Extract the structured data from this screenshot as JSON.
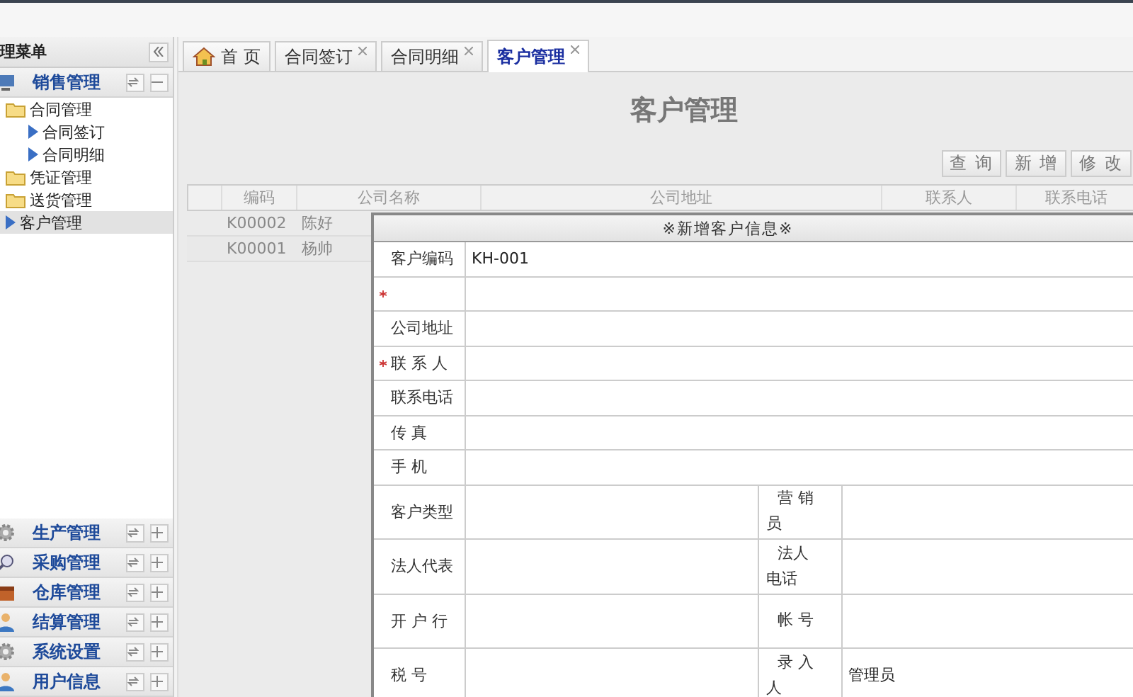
{
  "sidebar": {
    "title": "理菜单",
    "panels": [
      {
        "title": "销售管理",
        "kind": "sales",
        "expanded": true,
        "items": [
          {
            "label": "合同管理",
            "kind": "folder",
            "selected": false,
            "children": [
              {
                "label": "合同签订",
                "kind": "leaf",
                "selected": false
              },
              {
                "label": "合同明细",
                "kind": "leaf",
                "selected": false
              }
            ]
          },
          {
            "label": "凭证管理",
            "kind": "folder",
            "selected": false
          },
          {
            "label": "送货管理",
            "kind": "folder",
            "selected": false
          },
          {
            "label": "客户管理",
            "kind": "leaf",
            "selected": true
          }
        ]
      },
      {
        "title": "生产管理",
        "kind": "gear",
        "expanded": false
      },
      {
        "title": "采购管理",
        "kind": "search",
        "expanded": false
      },
      {
        "title": "仓库管理",
        "kind": "box",
        "expanded": false
      },
      {
        "title": "结算管理",
        "kind": "user",
        "expanded": false
      },
      {
        "title": "系统设置",
        "kind": "gear",
        "expanded": false
      },
      {
        "title": "用户信息",
        "kind": "user",
        "expanded": false
      }
    ]
  },
  "tabs": [
    {
      "label": "首 页",
      "kind": "home",
      "selected": false
    },
    {
      "label": "合同签订",
      "kind": "closable",
      "selected": false
    },
    {
      "label": "合同明细",
      "kind": "closable",
      "selected": false
    },
    {
      "label": "客户管理",
      "kind": "closable",
      "selected": true
    }
  ],
  "page": {
    "title": "客户管理",
    "buttons": [
      "查 询",
      "新 增",
      "修 改"
    ],
    "table": {
      "columns": [
        "编码",
        "公司名称",
        "公司地址",
        "联系人",
        "联系电话"
      ],
      "rows": [
        [
          "K00002",
          "陈好"
        ],
        [
          "K00001",
          "杨帅"
        ]
      ]
    }
  },
  "dialog": {
    "title": "※新增客户信息※",
    "rows": [
      {
        "kind": "single",
        "label": "客户编码",
        "required": false,
        "value": "KH-001"
      },
      {
        "kind": "single",
        "required": true
      },
      {
        "kind": "single",
        "label": "公司地址",
        "required": false
      },
      {
        "kind": "single",
        "label": "联 系 人",
        "required": true
      },
      {
        "kind": "single",
        "label": "联系电话",
        "required": false
      },
      {
        "kind": "single",
        "label": "传 真",
        "required": false
      },
      {
        "kind": "single",
        "label": "手 机",
        "required": false
      },
      {
        "kind": "pair",
        "label": "客户类型",
        "label2": "营 销员"
      },
      {
        "kind": "pair",
        "label": "法人代表",
        "label2": "法人电话"
      },
      {
        "kind": "pair",
        "label": "开 户 行",
        "label2": "帐 号"
      },
      {
        "kind": "pair",
        "label": "税 号",
        "label2": "录 入人",
        "value2": "管理员"
      }
    ]
  }
}
